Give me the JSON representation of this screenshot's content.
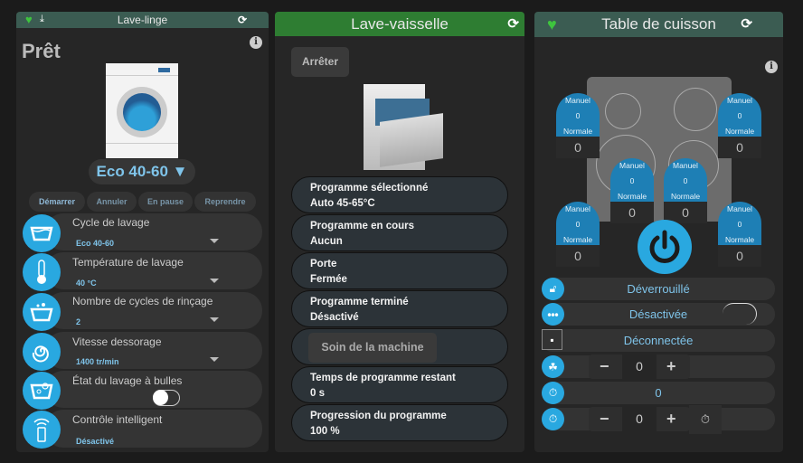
{
  "washer": {
    "title": "Lave-linge",
    "status": "Prêt",
    "program": "Eco 40-60 ▼",
    "actions": [
      "Démarrer",
      "Annuler",
      "En pause",
      "Reprendre"
    ],
    "settings": [
      {
        "label": "Cycle de lavage",
        "value": "Eco 40-60",
        "icon": "wash-tub-icon"
      },
      {
        "label": "Température de lavage",
        "value": "40 °C",
        "icon": "thermometer-icon"
      },
      {
        "label": "Nombre de cycles de rinçage",
        "value": "2",
        "icon": "rinse-icon"
      },
      {
        "label": "Vitesse dessorage",
        "value": "1400 tr/min",
        "icon": "spin-icon"
      },
      {
        "label": "État du lavage à bulles",
        "value": "",
        "icon": "bubble-wash-icon"
      },
      {
        "label": "Contrôle intelligent",
        "value": "Désactivé",
        "icon": "remote-control-icon"
      }
    ]
  },
  "dishwasher": {
    "title": "Lave-vaisselle",
    "stop": "Arrêter",
    "care": "Soin de la machine",
    "rows": [
      {
        "label": "Programme sélectionné",
        "value": "Auto 45-65°C"
      },
      {
        "label": "Programme en cours",
        "value": "Aucun"
      },
      {
        "label": "Porte",
        "value": "Fermée"
      },
      {
        "label": "Programme terminé",
        "value": "Désactivé"
      },
      {
        "label": "Temps de programme restant",
        "value": "0 s"
      },
      {
        "label": "Progression du programme",
        "value": "100 %"
      }
    ]
  },
  "cooktop": {
    "title": "Table de cuisson",
    "zones": [
      {
        "mode": "Manuel",
        "level": "0",
        "type": "Normale",
        "power": "0"
      },
      {
        "mode": "Manuel",
        "level": "0",
        "type": "Normale",
        "power": "0"
      },
      {
        "mode": "Manuel",
        "level": "0",
        "type": "Normale",
        "power": "0"
      },
      {
        "mode": "Manuel",
        "level": "0",
        "type": "Normale",
        "power": "0"
      },
      {
        "mode": "Manuel",
        "level": "0",
        "type": "Normale",
        "power": "0"
      },
      {
        "mode": "Manuel",
        "level": "0",
        "type": "Normale",
        "power": "0"
      }
    ],
    "lock": "Déverrouillé",
    "connection_mode": "Désactivée",
    "network": "Déconnectée",
    "power_boost": "0",
    "timer_remaining": "0",
    "timer_set": "0",
    "minus": "−",
    "plus": "+"
  },
  "colors": {
    "header_teal": "#3b5c52",
    "header_green": "#2e7d32",
    "accent": "#29a8e0"
  }
}
